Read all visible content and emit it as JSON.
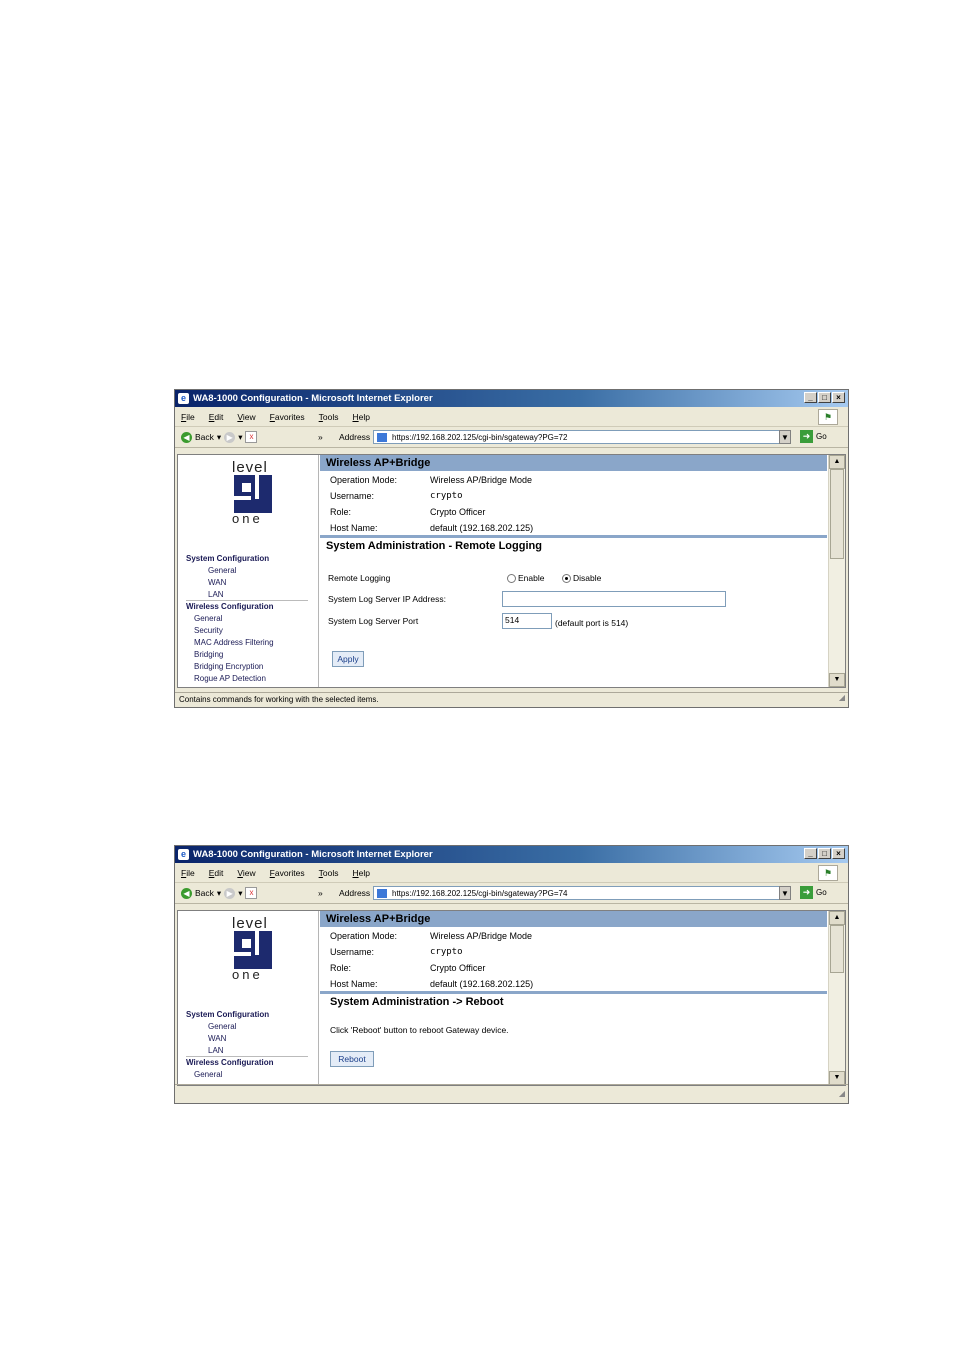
{
  "window1": {
    "title": "WA8-1000 Configuration - Microsoft Internet Explorer",
    "menu": [
      "File",
      "Edit",
      "View",
      "Favorites",
      "Tools",
      "Help"
    ],
    "back_label": "Back",
    "address_label": "Address",
    "url": "https://192.168.202.125/cgi-bin/sgateway?PG=72",
    "go_label": "Go",
    "logo_top": "level",
    "logo_bottom": "one",
    "nav": {
      "system_config": "System Configuration",
      "general": "General",
      "wan": "WAN",
      "lan": "LAN",
      "wireless_config": "Wireless Configuration",
      "w_general": "General",
      "w_security": "Security",
      "w_mac": "MAC Address Filtering",
      "w_bridging": "Bridging",
      "w_bridging_enc": "Bridging Encryption",
      "w_rogue": "Rogue AP Detection"
    },
    "band_title": "Wireless AP+Bridge",
    "info": {
      "op_mode_label": "Operation Mode:",
      "op_mode_value": "Wireless AP/Bridge Mode",
      "username_label": "Username:",
      "username_value": "crypto",
      "role_label": "Role:",
      "role_value": "Crypto Officer",
      "host_label": "Host Name:",
      "host_value": "default (192.168.202.125)"
    },
    "section_title": "System Administration - Remote Logging",
    "remote_logging_label": "Remote Logging",
    "enable_label": "Enable",
    "disable_label": "Disable",
    "server_ip_label": "System Log Server IP Address:",
    "server_ip_value": "",
    "server_port_label": "System Log Server Port",
    "server_port_value": "514",
    "port_hint": "(default port is 514)",
    "apply_label": "Apply",
    "status": "Contains commands for working with the selected items."
  },
  "window2": {
    "title": "WA8-1000 Configuration - Microsoft Internet Explorer",
    "menu": [
      "File",
      "Edit",
      "View",
      "Favorites",
      "Tools",
      "Help"
    ],
    "back_label": "Back",
    "address_label": "Address",
    "url": "https://192.168.202.125/cgi-bin/sgateway?PG=74",
    "go_label": "Go",
    "logo_top": "level",
    "logo_bottom": "one",
    "nav": {
      "system_config": "System Configuration",
      "general": "General",
      "wan": "WAN",
      "lan": "LAN",
      "wireless_config": "Wireless Configuration",
      "w_general": "General"
    },
    "band_title": "Wireless AP+Bridge",
    "info": {
      "op_mode_label": "Operation Mode:",
      "op_mode_value": "Wireless AP/Bridge Mode",
      "username_label": "Username:",
      "username_value": "crypto",
      "role_label": "Role:",
      "role_value": "Crypto Officer",
      "host_label": "Host Name:",
      "host_value": "default (192.168.202.125)"
    },
    "section_title": "System Administration -> Reboot",
    "reboot_text": "Click 'Reboot' button to reboot Gateway device.",
    "reboot_label": "Reboot"
  }
}
